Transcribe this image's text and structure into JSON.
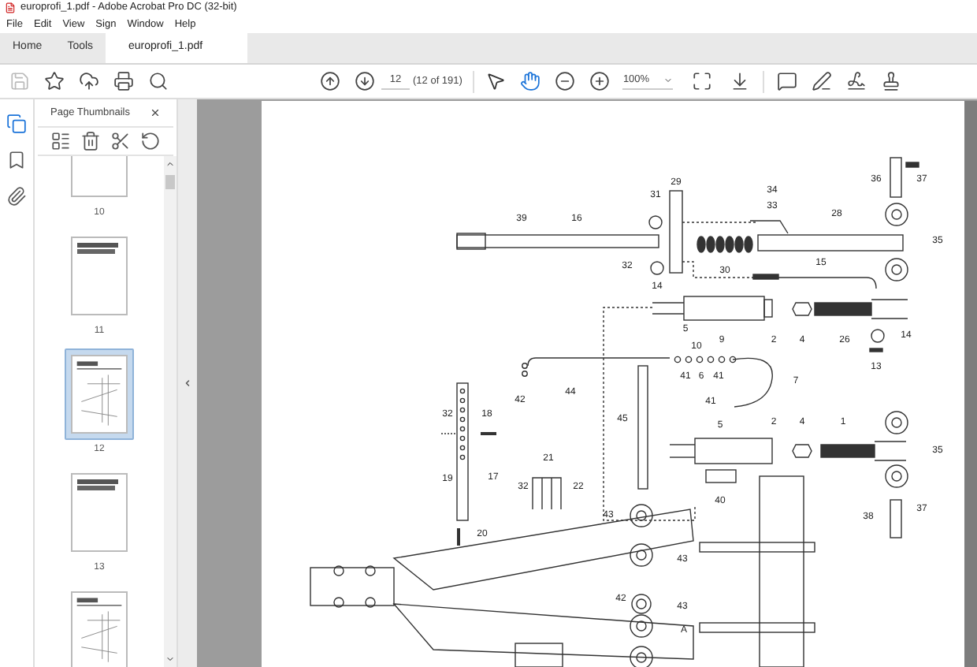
{
  "window": {
    "title": "europrofi_1.pdf - Adobe Acrobat Pro DC (32-bit)"
  },
  "menu": [
    "File",
    "Edit",
    "View",
    "Sign",
    "Window",
    "Help"
  ],
  "tabs": [
    {
      "label": "Home",
      "selected": false
    },
    {
      "label": "Tools",
      "selected": false
    },
    {
      "label": "europrofi_1.pdf",
      "selected": true
    }
  ],
  "toolbar": {
    "save_disabled": true,
    "page_number": "12",
    "page_count": "(12 of 191)",
    "zoom": "100%",
    "tools": [
      {
        "kind": "select",
        "selected": false
      },
      {
        "kind": "hand",
        "selected": true
      }
    ]
  },
  "side_rail": [
    {
      "kind": "pages",
      "selected": true
    },
    {
      "kind": "bookmarks",
      "selected": false
    },
    {
      "kind": "attachments",
      "selected": false
    }
  ],
  "panel": {
    "title": "Page Thumbnails",
    "thumbnails": [
      {
        "label": "10",
        "kind": "blank",
        "selected": false
      },
      {
        "label": "11",
        "kind": "text",
        "selected": false
      },
      {
        "label": "12",
        "kind": "diagram",
        "selected": true
      },
      {
        "label": "13",
        "kind": "text",
        "selected": false
      },
      {
        "kind": "diagram",
        "selected": false
      }
    ]
  },
  "diagram": {
    "labels": [
      "39",
      "16",
      "31",
      "29",
      "34",
      "33",
      "28",
      "36",
      "37",
      "35",
      "32",
      "14",
      "30",
      "15",
      "2",
      "4",
      "26",
      "14",
      "5",
      "9",
      "10",
      "13",
      "41",
      "6",
      "41",
      "7",
      "42",
      "44",
      "45",
      "32",
      "18",
      "41",
      "5",
      "2",
      "4",
      "1",
      "35",
      "21",
      "17",
      "19",
      "32",
      "22",
      "40",
      "37",
      "38",
      "43",
      "20",
      "43",
      "42",
      "43",
      "A"
    ]
  }
}
